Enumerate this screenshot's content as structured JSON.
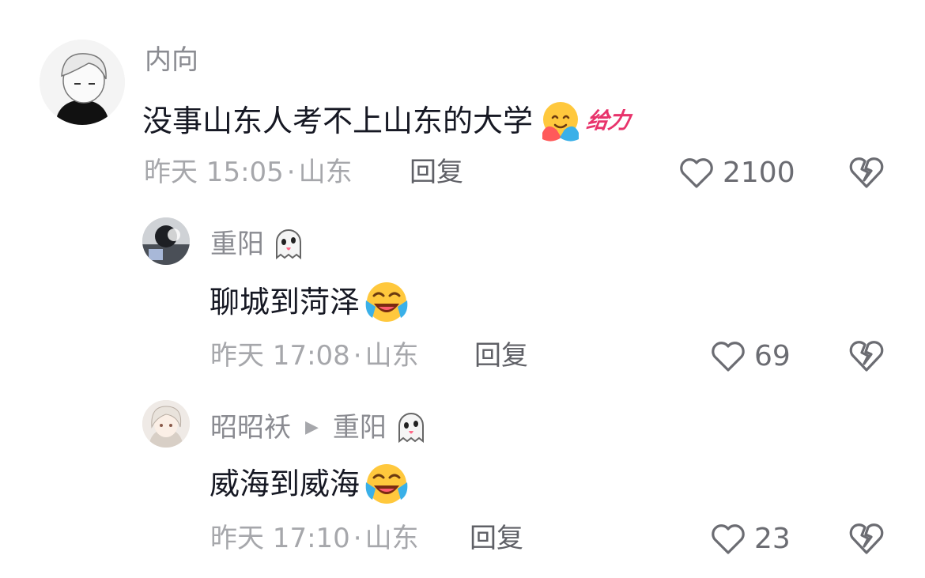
{
  "comments": [
    {
      "username": "内向",
      "text": "没事山东人考不上山东的大学",
      "sticker": "给力",
      "time": "昨天 15:05",
      "location": "山东",
      "reply_label": "回复",
      "likes": "2100",
      "avatar_icon": "anime-boy-avatar",
      "text_emoji": "hug-emoji"
    },
    {
      "username": "重阳",
      "text": "聊城到菏泽",
      "time": "昨天 17:08",
      "location": "山东",
      "reply_label": "回复",
      "likes": "69",
      "avatar_icon": "photo-avatar",
      "name_emoji": "ghost-emoji",
      "text_emoji": "laugh-cry-emoji"
    },
    {
      "username": "昭昭袄",
      "reply_to": "重阳",
      "text": "威海到威海",
      "time": "昨天 17:10",
      "location": "山东",
      "reply_label": "回复",
      "likes": "23",
      "avatar_icon": "anime-girl-avatar",
      "name_emoji": "ghost-emoji",
      "text_emoji": "laugh-cry-emoji"
    }
  ],
  "colors": {
    "text_primary": "#161823",
    "text_secondary": "#8a8b91",
    "sticker": "#e8336b"
  }
}
